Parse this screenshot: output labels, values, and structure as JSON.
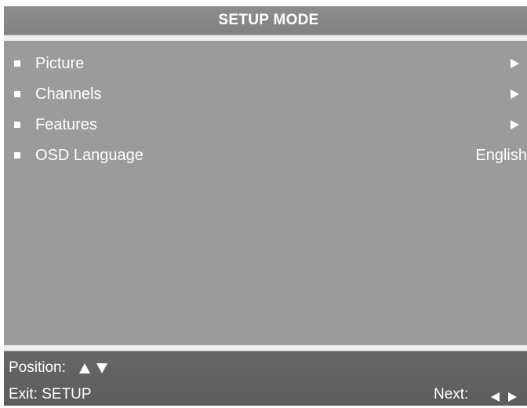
{
  "header": {
    "title": "SETUP MODE"
  },
  "menu": {
    "items": [
      {
        "label": "Picture",
        "value": "",
        "icon": "arrow-right-icon"
      },
      {
        "label": "Channels",
        "value": "",
        "icon": "arrow-right-icon"
      },
      {
        "label": "Features",
        "value": "",
        "icon": "arrow-right-icon"
      },
      {
        "label": "OSD Language",
        "value": "English",
        "icon": ""
      }
    ]
  },
  "footer": {
    "position_label": "Position:",
    "position_icons": [
      "arrow-up-icon",
      "arrow-down-icon"
    ],
    "exit_label": "Exit: SETUP",
    "next_label": "Next:",
    "next_icons": [
      "arrow-left-icon",
      "arrow-right-icon"
    ]
  },
  "colors": {
    "panel": "#9b9b9b",
    "header": "#868686",
    "footer": "#626262",
    "divider": "#eeeeee",
    "text": "#ffffff"
  }
}
